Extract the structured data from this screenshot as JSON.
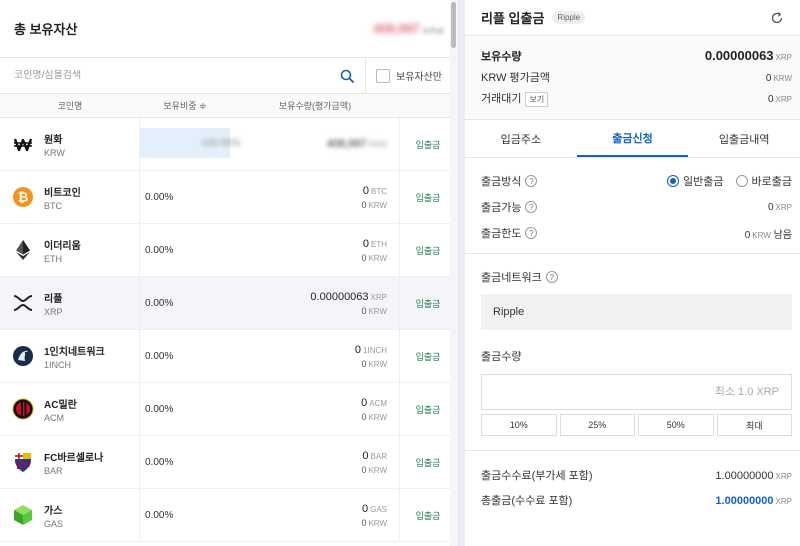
{
  "assets": {
    "title": "총 보유자산",
    "total_value": "408,997",
    "total_unit": "KRW",
    "search_placeholder": "코인명/심볼검색",
    "owned_only_label": "보유자산만",
    "columns": {
      "name": "코인명",
      "ratio": "보유비중 ≑",
      "amount": "보유수량(평가금액)"
    },
    "rows": [
      {
        "kor": "원화",
        "eng": "KRW",
        "icon": "won-icon",
        "ratio": "100.00%",
        "amount": "408,997",
        "amount_unit": "KRW",
        "krw": "",
        "action": "입출금",
        "blurred": true
      },
      {
        "kor": "비트코인",
        "eng": "BTC",
        "icon": "bitcoin-icon",
        "ratio": "0.00%",
        "amount": "0",
        "amount_unit": "BTC",
        "krw": "0",
        "action": "입출금"
      },
      {
        "kor": "이더리움",
        "eng": "ETH",
        "icon": "ethereum-icon",
        "ratio": "0.00%",
        "amount": "0",
        "amount_unit": "ETH",
        "krw": "0",
        "action": "입출금"
      },
      {
        "kor": "리플",
        "eng": "XRP",
        "icon": "ripple-icon",
        "ratio": "0.00%",
        "amount": "0.00000063",
        "amount_unit": "XRP",
        "krw": "0",
        "action": "입출금",
        "selected": true
      },
      {
        "kor": "1인치네트워크",
        "eng": "1INCH",
        "icon": "1inch-icon",
        "ratio": "0.00%",
        "amount": "0",
        "amount_unit": "1INCH",
        "krw": "0",
        "action": "입출금"
      },
      {
        "kor": "AC밀란",
        "eng": "ACM",
        "icon": "acmilan-icon",
        "ratio": "0.00%",
        "amount": "0",
        "amount_unit": "ACM",
        "krw": "0",
        "action": "입출금"
      },
      {
        "kor": "FC바르셀로나",
        "eng": "BAR",
        "icon": "fcbarcelona-icon",
        "ratio": "0.00%",
        "amount": "0",
        "amount_unit": "BAR",
        "krw": "0",
        "action": "입출금"
      },
      {
        "kor": "가스",
        "eng": "GAS",
        "icon": "gas-icon",
        "ratio": "0.00%",
        "amount": "0",
        "amount_unit": "GAS",
        "krw": "0",
        "action": "입출금"
      }
    ],
    "krw_unit": "KRW"
  },
  "panel": {
    "title": "리플 입출금",
    "badge": "Ripple",
    "holding_label": "보유수량",
    "holding_value": "0.00000063",
    "holding_unit": "XRP",
    "krw_eval_label": "KRW 평가금액",
    "krw_eval_value": "0",
    "krw_eval_unit": "KRW",
    "pending_label": "거래대기",
    "view_label": "보기",
    "pending_value": "0",
    "pending_unit": "XRP",
    "tabs": [
      "입금주소",
      "출금신청",
      "입출금내역"
    ],
    "method_label": "출금방식",
    "method_normal": "일반출금",
    "method_instant": "바로출금",
    "available_label": "출금가능",
    "available_value": "0",
    "available_unit": "XRP",
    "limit_label": "출금한도",
    "limit_value": "0",
    "limit_unit": "KRW",
    "limit_suffix": "남음",
    "network_label": "출금네트워크",
    "network_value": "Ripple",
    "qty_label": "출금수량",
    "qty_placeholder": "최소 1.0 XRP",
    "pct_buttons": [
      "10%",
      "25%",
      "50%",
      "최대"
    ],
    "fee_label": "출금수수료(부가세 포함)",
    "fee_value": "1.00000000",
    "fee_unit": "XRP",
    "total_label": "총출금(수수료 포함)",
    "total_value": "1.00000000",
    "total_unit": "XRP"
  }
}
